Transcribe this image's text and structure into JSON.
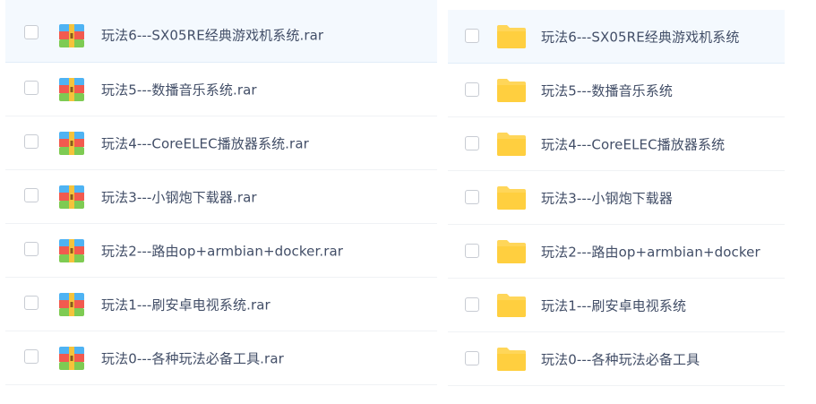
{
  "left_list": {
    "items": [
      {
        "name": "玩法6---SX05RE经典游戏机系统.rar",
        "icon": "rar-archive-icon"
      },
      {
        "name": "玩法5---数播音乐系统.rar",
        "icon": "rar-archive-icon"
      },
      {
        "name": "玩法4---CoreELEC播放器系统.rar",
        "icon": "rar-archive-icon"
      },
      {
        "name": "玩法3---小钢炮下载器.rar",
        "icon": "rar-archive-icon"
      },
      {
        "name": "玩法2---路由op+armbian+docker.rar",
        "icon": "rar-archive-icon"
      },
      {
        "name": "玩法1---刷安卓电视系统.rar",
        "icon": "rar-archive-icon"
      },
      {
        "name": "玩法0---各种玩法必备工具.rar",
        "icon": "rar-archive-icon"
      }
    ]
  },
  "right_list": {
    "items": [
      {
        "name": "玩法6---SX05RE经典游戏机系统",
        "icon": "folder-icon"
      },
      {
        "name": "玩法5---数播音乐系统",
        "icon": "folder-icon"
      },
      {
        "name": "玩法4---CoreELEC播放器系统",
        "icon": "folder-icon"
      },
      {
        "name": "玩法3---小钢炮下载器",
        "icon": "folder-icon"
      },
      {
        "name": "玩法2---路由op+armbian+docker",
        "icon": "folder-icon"
      },
      {
        "name": "玩法1---刷安卓电视系统",
        "icon": "folder-icon"
      },
      {
        "name": "玩法0---各种玩法必备工具",
        "icon": "folder-icon"
      }
    ]
  },
  "colors": {
    "text": "#424e67",
    "selected_row_bg": "#f4f9fe",
    "folder": "#ffd659",
    "archive_top": "#4fb3f3",
    "archive_middle": "#f25a4f",
    "archive_bottom": "#7ecb53",
    "archive_band": "#f5c33b"
  }
}
